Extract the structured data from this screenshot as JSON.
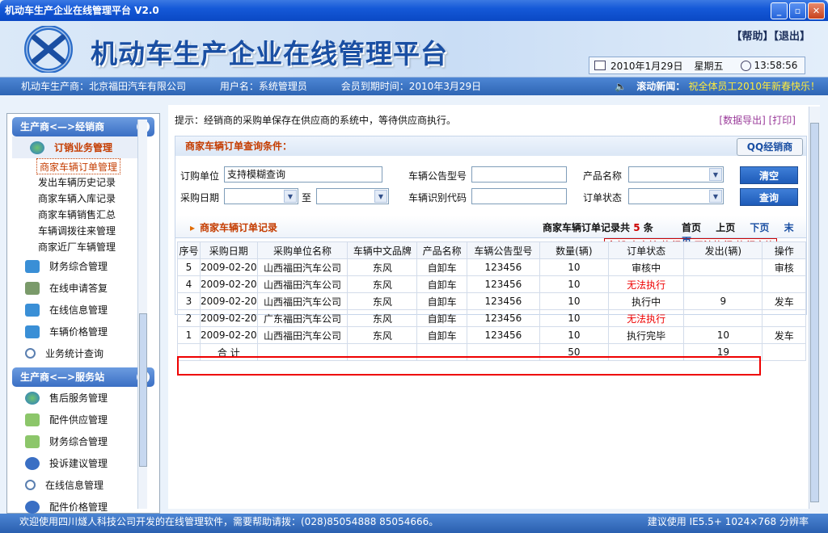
{
  "window": {
    "title": "机动车生产企业在线管理平台 V2.0",
    "min": "_",
    "max": "▫",
    "close": "✕"
  },
  "header": {
    "app_title": "机动车生产企业在线管理平台",
    "links": "【帮助】【退出】",
    "date": "2010年1月29日",
    "weekday": "星期五",
    "time": "13:58:56"
  },
  "info": {
    "maker": "机动车生产商：北京福田汽车有限公司",
    "user": "用户名：系统管理员",
    "expire": "会员到期时间：2010年3月29日",
    "news_label": "滚动新闻：",
    "news_text": "祝全体员工2010年新春快乐！"
  },
  "sidebar": {
    "sec1": "生产商<—>经销商",
    "order_mgmt": "订销业务管理",
    "subs": [
      "商家车辆订单管理",
      "发出车辆历史记录",
      "商家车辆入库记录",
      "商家车辆销售汇总",
      "车辆调拨往来管理",
      "商家近厂车辆管理"
    ],
    "items1": [
      "财务综合管理",
      "在线申请答复",
      "在线信息管理",
      "车辆价格管理",
      "业务统计查询"
    ],
    "sec2": "生产商<—>服务站",
    "items2": [
      "售后服务管理",
      "配件供应管理",
      "财务综合管理",
      "投诉建议管理",
      "在线信息管理",
      "配件价格管理"
    ]
  },
  "main": {
    "hint": "提示：经销商的采购单保存在供应商的系统中，等待供应商执行。",
    "export": "[数据导出]",
    "print": "[打印]",
    "query_title": "商家车辆订单查询条件：",
    "qq": "QQ经销商",
    "f_unit": "订购单位",
    "f_unit_val": "支持模糊查询",
    "f_notice": "车辆公告型号",
    "f_product": "产品名称",
    "f_date": "采购日期",
    "f_to": "至",
    "f_vin": "车辆识别代码",
    "f_status": "订单状态",
    "btn_clear": "清空",
    "btn_query": "查询",
    "status_tip": "全部/未审核/执行中/无法执行/执行完毕",
    "result_title": "商家车辆订单记录",
    "count_pre": "商家车辆订单记录共",
    "count": "5",
    "count_post": "条",
    "pager": [
      "首页",
      "上页",
      "下页",
      "末页"
    ]
  },
  "table": {
    "headers": [
      "序号",
      "采购日期",
      "采购单位名称",
      "车辆中文品牌",
      "产品名称",
      "车辆公告型号",
      "数量(辆)",
      "订单状态",
      "发出(辆)",
      "操作"
    ],
    "rows": [
      [
        "5",
        "2009-02-20",
        "山西福田汽车公司",
        "东风",
        "自卸车",
        "123456",
        "10",
        "审核中",
        "",
        "审核"
      ],
      [
        "4",
        "2009-02-20",
        "山西福田汽车公司",
        "东风",
        "自卸车",
        "123456",
        "10",
        "无法执行",
        "",
        ""
      ],
      [
        "3",
        "2009-02-20",
        "山西福田汽车公司",
        "东风",
        "自卸车",
        "123456",
        "10",
        "执行中",
        "9",
        "发车"
      ],
      [
        "2",
        "2009-02-20",
        "广东福田汽车公司",
        "东风",
        "自卸车",
        "123456",
        "10",
        "无法执行",
        "",
        ""
      ],
      [
        "1",
        "2009-02-20",
        "山西福田汽车公司",
        "东风",
        "自卸车",
        "123456",
        "10",
        "执行完毕",
        "10",
        "发车"
      ]
    ],
    "total_label": "合 计",
    "total_qty": "50",
    "total_sent": "19"
  },
  "status": {
    "left": "欢迎使用四川燧人科技公司开发的在线管理软件，需要帮助请拨：(028)85054888 85054666。",
    "right": "建议使用 IE5.5+ 1024×768 分辨率"
  }
}
